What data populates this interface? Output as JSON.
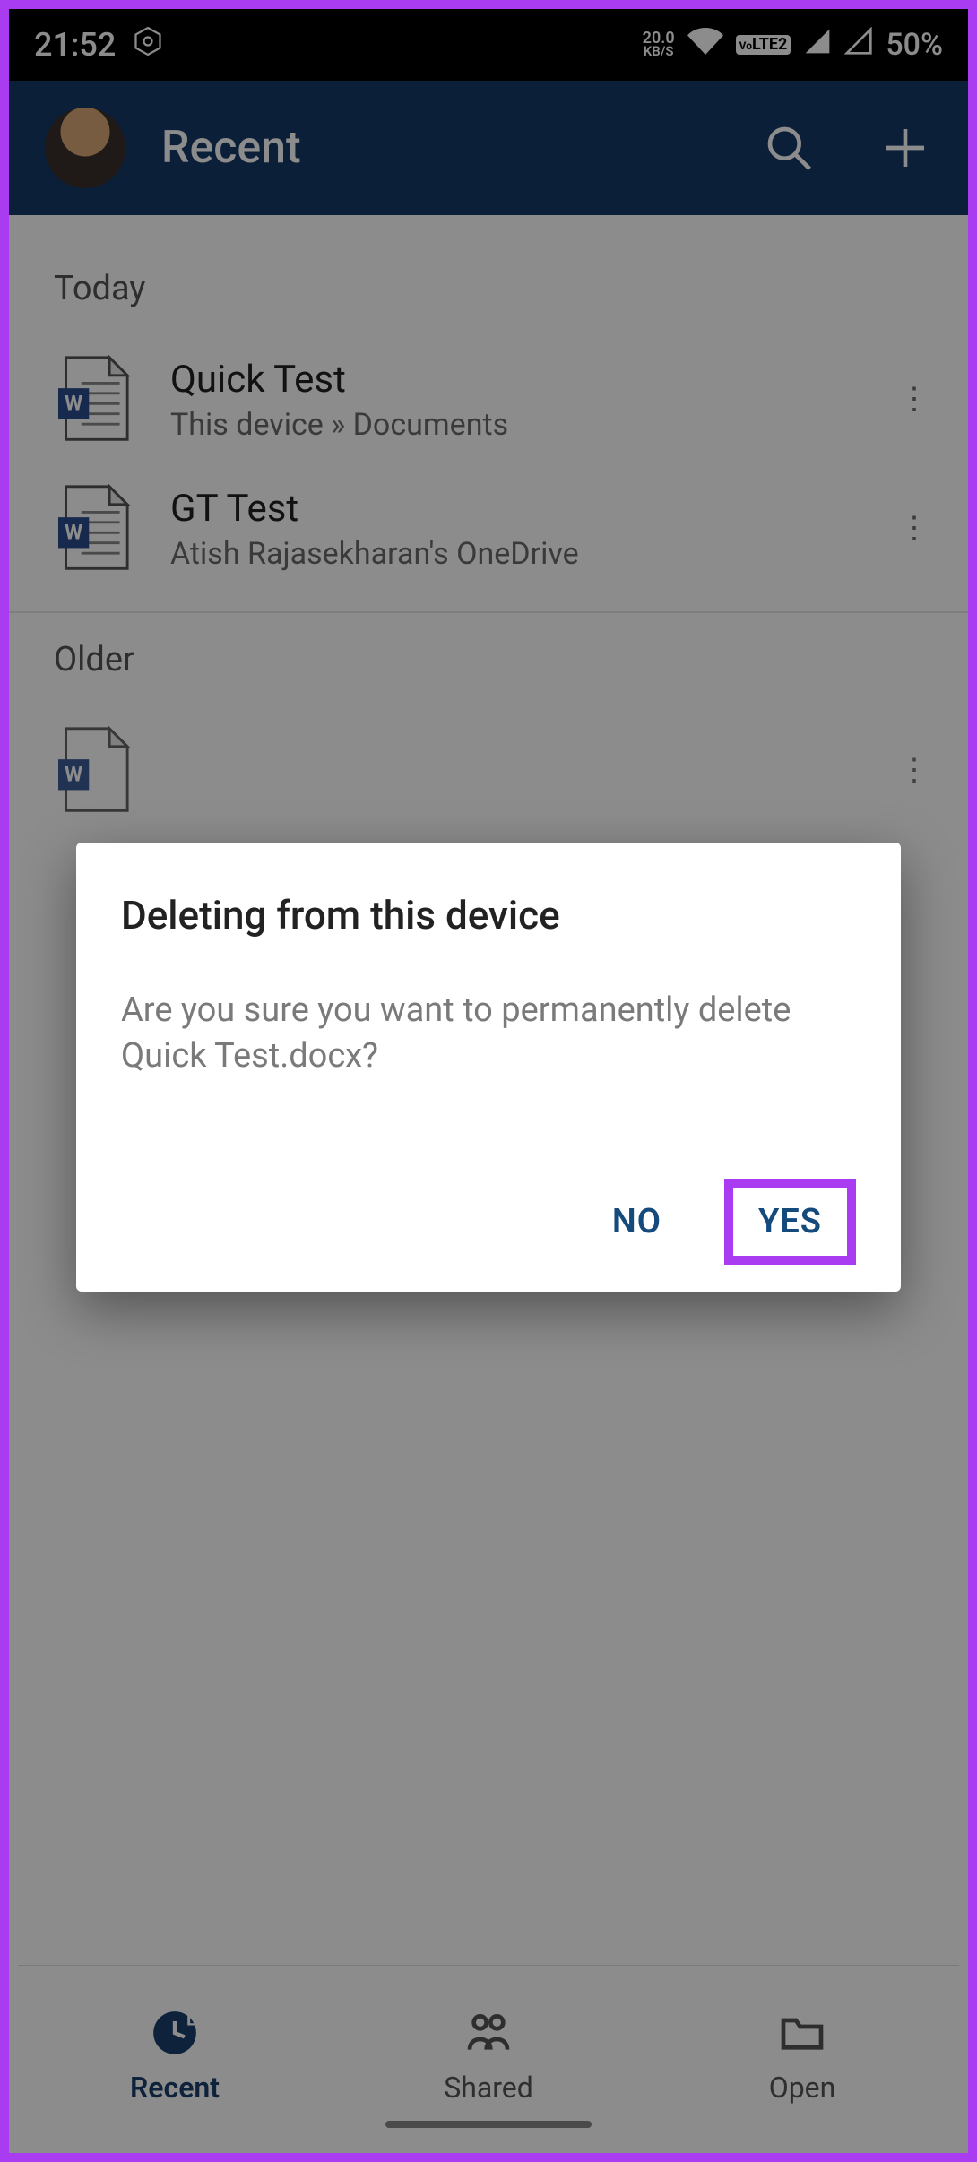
{
  "status": {
    "time": "21:52",
    "net_speed_value": "20.0",
    "net_speed_unit": "KB/S",
    "volte": "LTE2",
    "volte_prefix": "Vo",
    "battery": "50%"
  },
  "header": {
    "title": "Recent"
  },
  "sections": [
    {
      "label": "Today",
      "files": [
        {
          "name": "Quick Test",
          "location": "This device » Documents"
        },
        {
          "name": "GT Test",
          "location": "Atish Rajasekharan's OneDrive"
        }
      ]
    },
    {
      "label": "Older",
      "files": [
        {
          "name": "",
          "location": ""
        }
      ]
    }
  ],
  "dialog": {
    "title": "Deleting from this device",
    "body": "Are you sure you want to permanently delete Quick Test.docx?",
    "no": "NO",
    "yes": "YES"
  },
  "nav": {
    "recent": "Recent",
    "shared": "Shared",
    "open": "Open"
  }
}
